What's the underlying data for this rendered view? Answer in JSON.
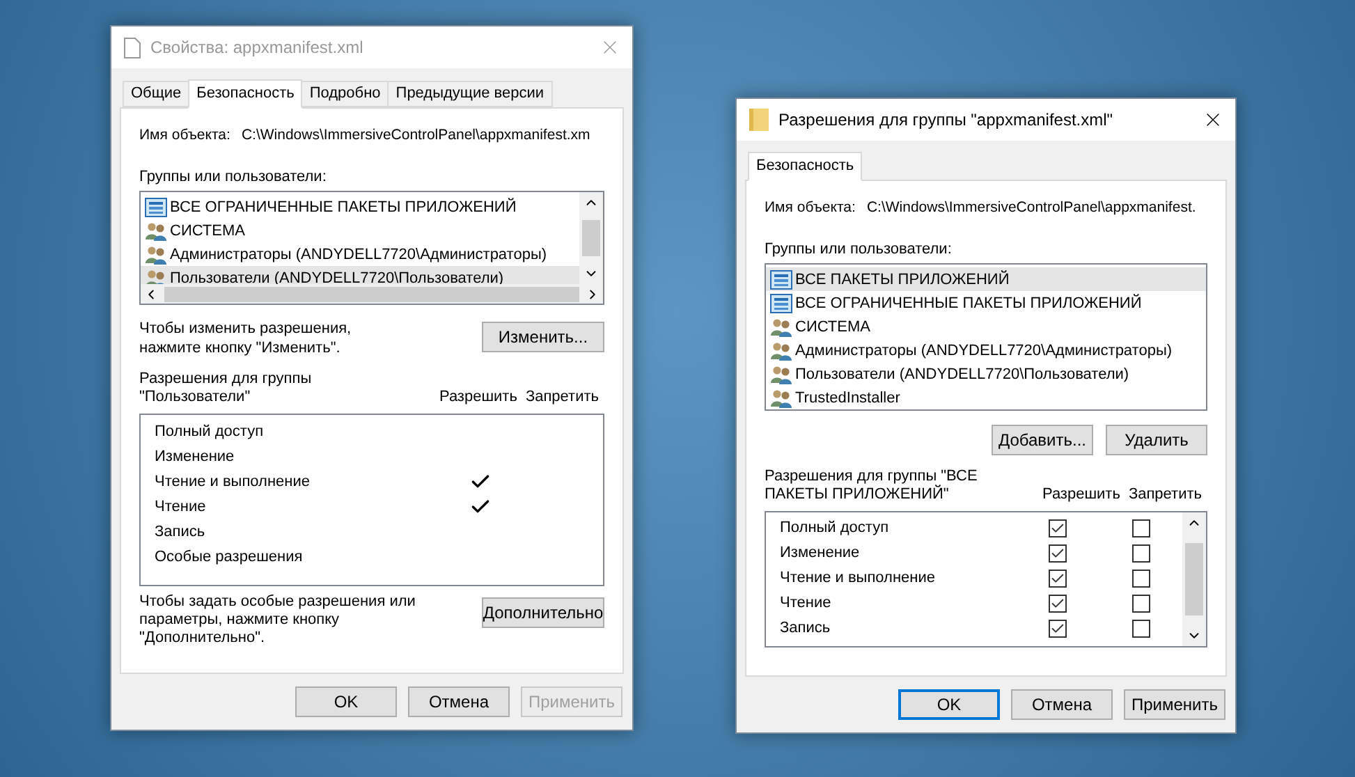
{
  "windows": [
    {
      "kind": "properties",
      "active": false,
      "title": "Свойства: appxmanifest.xml",
      "tabs": [
        {
          "label": "Общие",
          "selected": false
        },
        {
          "label": "Безопасность",
          "selected": true
        },
        {
          "label": "Подробно",
          "selected": false
        },
        {
          "label": "Предыдущие версии",
          "selected": false
        }
      ],
      "object_label": "Имя объекта:",
      "object_value": "C:\\Windows\\ImmersiveControlPanel\\appxmanifest.xm",
      "groups_label": "Группы или пользователи:",
      "groups": [
        {
          "kind": "package",
          "name": "ВСЕ ОГРАНИЧЕННЫЕ ПАКЕТЫ ПРИЛОЖЕНИЙ",
          "selected": false
        },
        {
          "kind": "users",
          "name": "СИСТЕМА",
          "selected": false
        },
        {
          "kind": "users",
          "name": "Администраторы (ANDYDELL7720\\Администраторы)",
          "selected": false
        },
        {
          "kind": "users",
          "name": "Пользователи (ANDYDELL7720\\Пользователи)",
          "selected": true
        }
      ],
      "change_hint": "Чтобы изменить разрешения, нажмите кнопку \"Изменить\".",
      "change_button": "Изменить...",
      "permissions_label": "Разрешения для группы \"Пользователи\"",
      "allow_header": "Разрешить",
      "deny_header": "Запретить",
      "permissions": [
        {
          "name": "Полный доступ",
          "allow": false,
          "deny": false
        },
        {
          "name": "Изменение",
          "allow": false,
          "deny": false
        },
        {
          "name": "Чтение и выполнение",
          "allow": true,
          "deny": false
        },
        {
          "name": "Чтение",
          "allow": true,
          "deny": false
        },
        {
          "name": "Запись",
          "allow": false,
          "deny": false
        },
        {
          "name": "Особые разрешения",
          "allow": false,
          "deny": false
        }
      ],
      "advanced_hint": "Чтобы задать особые разрешения или параметры, нажмите кнопку \"Дополнительно\".",
      "advanced_button": "Дополнительно",
      "buttons": [
        {
          "label": "OK",
          "default": false,
          "disabled": false
        },
        {
          "label": "Отмена",
          "default": false,
          "disabled": false
        },
        {
          "label": "Применить",
          "default": false,
          "disabled": true
        }
      ]
    },
    {
      "kind": "permissions",
      "active": true,
      "title": "Разрешения для группы \"appxmanifest.xml\"",
      "tabs": [
        {
          "label": "Безопасность",
          "selected": true
        }
      ],
      "object_label": "Имя объекта:",
      "object_value": "C:\\Windows\\ImmersiveControlPanel\\appxmanifest.",
      "groups_label": "Группы или пользователи:",
      "groups": [
        {
          "kind": "package",
          "name": "ВСЕ ПАКЕТЫ ПРИЛОЖЕНИЙ",
          "selected": true
        },
        {
          "kind": "package",
          "name": "ВСЕ ОГРАНИЧЕННЫЕ ПАКЕТЫ ПРИЛОЖЕНИЙ",
          "selected": false
        },
        {
          "kind": "users",
          "name": "СИСТЕМА",
          "selected": false
        },
        {
          "kind": "users",
          "name": "Администраторы (ANDYDELL7720\\Администраторы)",
          "selected": false
        },
        {
          "kind": "users",
          "name": "Пользователи (ANDYDELL7720\\Пользователи)",
          "selected": false
        },
        {
          "kind": "users",
          "name": "TrustedInstaller",
          "selected": false
        }
      ],
      "add_button": "Добавить...",
      "remove_button": "Удалить",
      "permissions_label": "Разрешения для группы \"ВСЕ ПАКЕТЫ ПРИЛОЖЕНИЙ\"",
      "allow_header": "Разрешить",
      "deny_header": "Запретить",
      "permissions": [
        {
          "name": "Полный доступ",
          "allow": true,
          "deny": false
        },
        {
          "name": "Изменение",
          "allow": true,
          "deny": false
        },
        {
          "name": "Чтение и выполнение",
          "allow": true,
          "deny": false
        },
        {
          "name": "Чтение",
          "allow": true,
          "deny": false
        },
        {
          "name": "Запись",
          "allow": true,
          "deny": false
        }
      ],
      "buttons": [
        {
          "label": "OK",
          "default": true,
          "disabled": false
        },
        {
          "label": "Отмена",
          "default": false,
          "disabled": false
        },
        {
          "label": "Применить",
          "default": false,
          "disabled": false
        }
      ]
    }
  ]
}
